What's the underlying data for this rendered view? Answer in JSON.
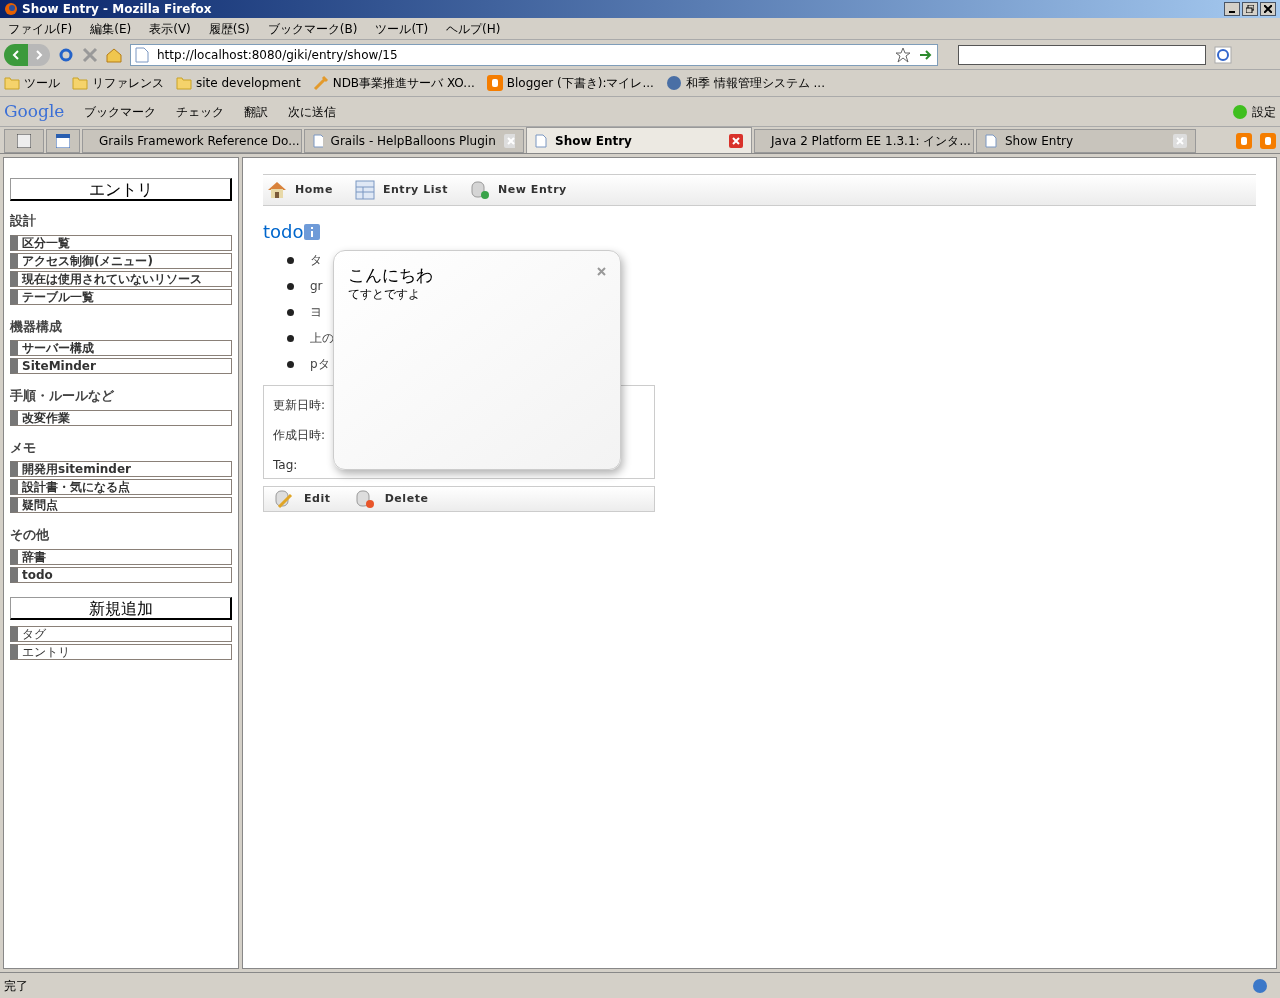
{
  "window": {
    "title": "Show Entry - Mozilla Firefox"
  },
  "menu": [
    "ファイル(F)",
    "編集(E)",
    "表示(V)",
    "履歴(S)",
    "ブックマーク(B)",
    "ツール(T)",
    "ヘルプ(H)"
  ],
  "nav": {
    "url": "http://localhost:8080/giki/entry/show/15"
  },
  "bookmarks": [
    {
      "label": "ツール",
      "kind": "folder"
    },
    {
      "label": "リファレンス",
      "kind": "folder"
    },
    {
      "label": "site development",
      "kind": "folder"
    },
    {
      "label": "NDB事業推進サーバ XO...",
      "kind": "tool"
    },
    {
      "label": "Blogger (下書き):マイレ...",
      "kind": "blogger"
    },
    {
      "label": "和季 情報管理システム ...",
      "kind": "app"
    }
  ],
  "google_toolbar": {
    "logo": "Google",
    "items": [
      "ブックマーク",
      "チェック",
      "翻訳",
      "次に送信"
    ],
    "settings": "設定"
  },
  "tabs": [
    {
      "label": "Grails Framework Reference Do...",
      "selected": false
    },
    {
      "label": "Grails - HelpBalloons Plugin",
      "selected": false
    },
    {
      "label": "Show Entry",
      "selected": true
    },
    {
      "label": "Java 2 Platform EE 1.3.1: インタ...",
      "selected": false
    },
    {
      "label": "Show Entry",
      "selected": false
    }
  ],
  "sidebar": {
    "header": "エントリ",
    "sections": [
      {
        "title": "設計",
        "items": [
          "区分一覧",
          "アクセス制御(メニュー)",
          "現在は使用されていないリソース",
          "テーブル一覧"
        ]
      },
      {
        "title": "機器構成",
        "items": [
          "サーバー構成",
          "SiteMinder"
        ]
      },
      {
        "title": "手順・ルールなど",
        "items": [
          "改変作業"
        ]
      },
      {
        "title": "メモ",
        "items": [
          "開発用siteminder",
          "設計書・気になる点",
          "疑問点"
        ]
      },
      {
        "title": "その他",
        "items": [
          "辞書",
          "todo"
        ]
      }
    ],
    "add_header": "新規追加",
    "add_items": [
      "タグ",
      "エントリ"
    ]
  },
  "main_nav": [
    {
      "label": "Home",
      "kind": "home"
    },
    {
      "label": "Entry List",
      "kind": "list"
    },
    {
      "label": "New Entry",
      "kind": "new"
    }
  ],
  "entry": {
    "title": "todo",
    "items": [
      "タ",
      "gr",
      "ヨ",
      "上の",
      "pタ"
    ],
    "meta": [
      "更新日時:",
      "作成日時:",
      "Tag:"
    ]
  },
  "actions": [
    {
      "label": "Edit",
      "kind": "edit"
    },
    {
      "label": "Delete",
      "kind": "delete"
    }
  ],
  "balloon": {
    "title": "こんにちわ",
    "body": "てすとですよ"
  },
  "status_bar": {
    "text": "完了"
  }
}
